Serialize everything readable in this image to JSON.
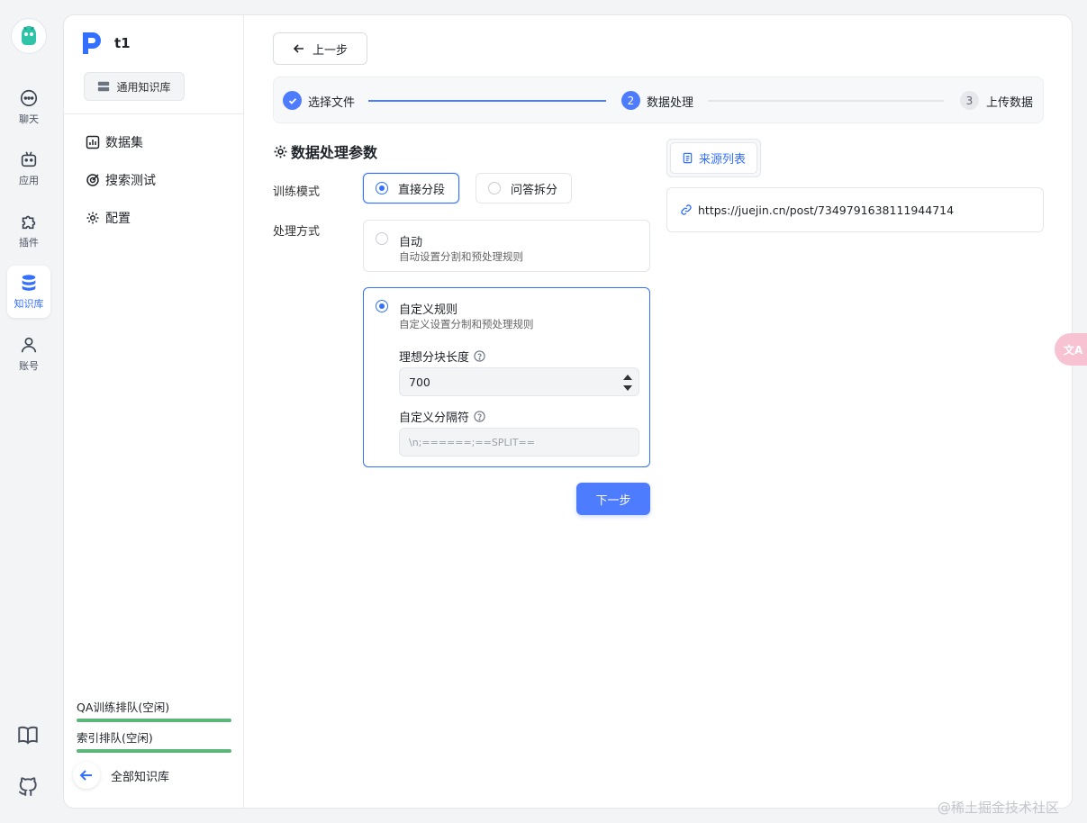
{
  "rail": {
    "items": [
      {
        "label": "聊天"
      },
      {
        "label": "应用"
      },
      {
        "label": "插件"
      },
      {
        "label": "知识库"
      },
      {
        "label": "账号"
      }
    ]
  },
  "sidebar": {
    "kb_name": "t1",
    "kb_type": "通用知识库",
    "menu": [
      {
        "label": "数据集"
      },
      {
        "label": "搜索测试"
      },
      {
        "label": "配置"
      }
    ],
    "queues": [
      {
        "label": "QA训练排队(空闲)"
      },
      {
        "label": "索引排队(空闲)"
      }
    ],
    "back_all": "全部知识库"
  },
  "toolbar": {
    "prev_label": "上一步"
  },
  "steps": [
    {
      "index": "1",
      "label": "选择文件",
      "status": "done"
    },
    {
      "index": "2",
      "label": "数据处理",
      "status": "active"
    },
    {
      "index": "3",
      "label": "上传数据",
      "status": "pending"
    }
  ],
  "form": {
    "title": "数据处理参数",
    "training_mode_label": "训练模式",
    "training_modes": [
      {
        "label": "直接分段",
        "selected": true
      },
      {
        "label": "问答拆分",
        "selected": false
      }
    ],
    "process_label": "处理方式",
    "process_modes": [
      {
        "title": "自动",
        "desc": "自动设置分割和预处理规则",
        "selected": false
      },
      {
        "title": "自定义规则",
        "desc": "自定义设置分制和预处理规则",
        "selected": true
      }
    ],
    "chunk_size_label": "理想分块长度",
    "chunk_size_value": "700",
    "separator_label": "自定义分隔符",
    "separator_placeholder": "\\n;======;==SPLIT==",
    "next_label": "下一步"
  },
  "source": {
    "tab_label": "来源列表",
    "items": [
      {
        "url": "https://juejin.cn/post/7349791638111944714"
      }
    ]
  },
  "misc": {
    "translate_label": "文A",
    "watermark": "@稀土掘金技术社区"
  },
  "colors": {
    "accent": "#3370ff",
    "queue_bar": "#5cb67a"
  }
}
